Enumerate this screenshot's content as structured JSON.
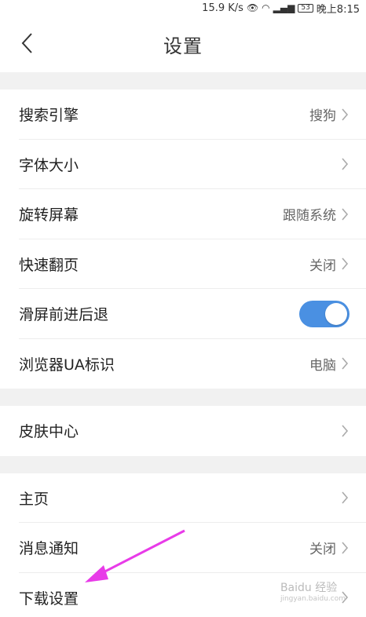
{
  "statusbar": {
    "speed": "15.9 K/s",
    "battery": "53",
    "time": "晚上8:15"
  },
  "header": {
    "title": "设置"
  },
  "groups": [
    [
      {
        "label": "搜索引擎",
        "value": "搜狗"
      },
      {
        "label": "字体大小",
        "value": ""
      },
      {
        "label": "旋转屏幕",
        "value": "跟随系统"
      },
      {
        "label": "快速翻页",
        "value": "关闭"
      },
      {
        "label": "滑屏前进后退",
        "toggle": true,
        "toggle_on": true
      },
      {
        "label": "浏览器UA标识",
        "value": "电脑"
      }
    ],
    [
      {
        "label": "皮肤中心",
        "value": ""
      }
    ],
    [
      {
        "label": "主页",
        "value": ""
      },
      {
        "label": "消息通知",
        "value": "关闭"
      },
      {
        "label": "下载设置",
        "value": ""
      }
    ]
  ],
  "watermark": {
    "text": "Baidu 经验",
    "url": "jingyan.baidu.com"
  },
  "colors": {
    "accent": "#4a90e2",
    "annotation": "#e83be8"
  }
}
